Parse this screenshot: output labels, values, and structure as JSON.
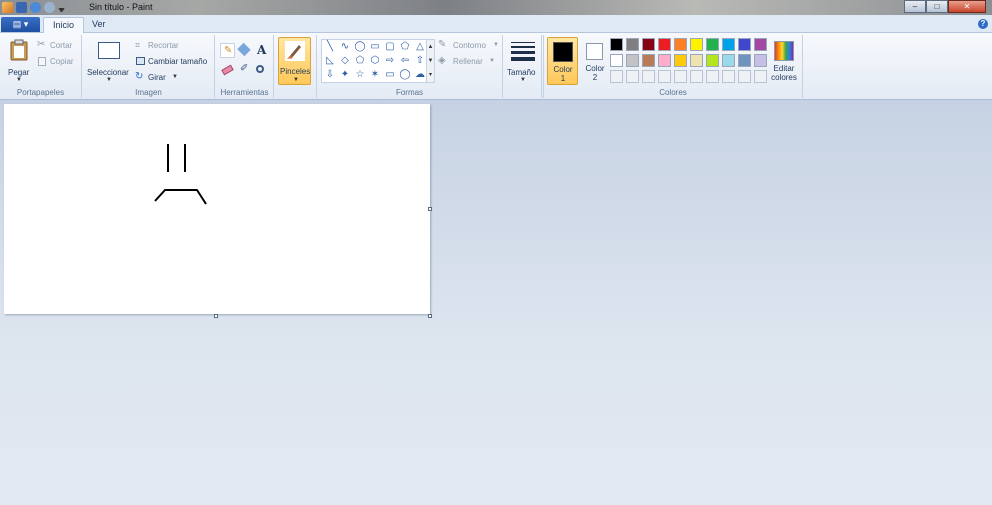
{
  "window": {
    "title": "Sin título - Paint",
    "controls": [
      "minimize",
      "maximize",
      "close"
    ]
  },
  "menu": {
    "label": "▤ ▾"
  },
  "tabs": [
    {
      "label": "Inicio",
      "active": true
    },
    {
      "label": "Ver",
      "active": false
    }
  ],
  "help_label": "?",
  "clipboard": {
    "group_label": "Portapapeles",
    "paste": "Pegar",
    "cut": "Cortar",
    "copy": "Copiar"
  },
  "image": {
    "group_label": "Imagen",
    "select": "Seleccionar",
    "crop": "Recortar",
    "resize": "Cambiar tamaño",
    "rotate": "Girar"
  },
  "tools": {
    "group_label": "Herramientas",
    "items": [
      "pencil-icon",
      "fill-icon",
      "text-icon",
      "eraser-icon",
      "color-picker-icon",
      "magnifier-icon"
    ],
    "text_glyph": "A"
  },
  "brushes": {
    "label": "Pinceles"
  },
  "shapes": {
    "group_label": "Formas",
    "outline": "Contorno",
    "fill": "Rellenar",
    "glyphs": [
      "╲",
      "∿",
      "◯",
      "▭",
      "▢",
      "⬠",
      "△",
      "◺",
      "◇",
      "⬠",
      "⬡",
      "⇨",
      "⇦",
      "⇧",
      "⇩",
      "✦",
      "☆",
      "✶",
      "▭",
      "◯",
      "☁"
    ]
  },
  "size": {
    "label": "Tamaño"
  },
  "color1": {
    "label": "Color 1",
    "value": "#000000"
  },
  "color2": {
    "label": "Color 2",
    "value": "#ffffff"
  },
  "colors": {
    "group_label": "Colores",
    "row1": [
      "#000000",
      "#7f7f7f",
      "#880015",
      "#ed1c24",
      "#ff7f27",
      "#fff200",
      "#22b14c",
      "#00a2e8",
      "#3f48cc",
      "#a349a4"
    ],
    "row2": [
      "#ffffff",
      "#c3c3c3",
      "#b97a57",
      "#ffaec9",
      "#ffc90e",
      "#efe4b0",
      "#b5e61d",
      "#99d9ea",
      "#7092be",
      "#c8bfe7"
    ],
    "edit_label": "Editar colores"
  }
}
